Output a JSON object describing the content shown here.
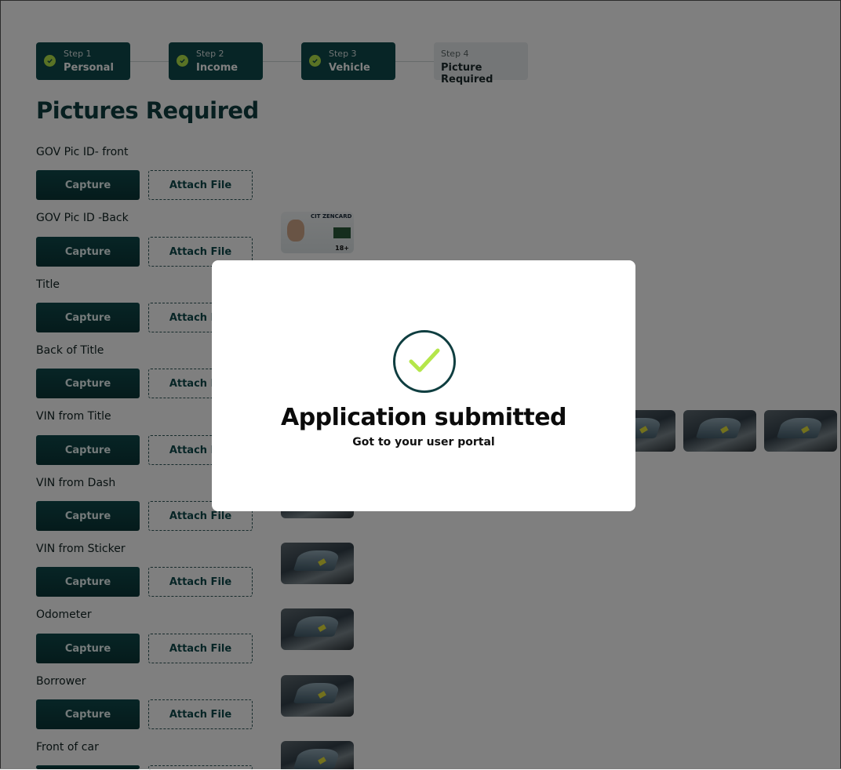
{
  "stepper": [
    {
      "num": "Step 1",
      "name": "Personal",
      "done": true
    },
    {
      "num": "Step 2",
      "name": "Income",
      "done": true
    },
    {
      "num": "Step 3",
      "name": "Vehicle",
      "done": true
    },
    {
      "num": "Step 4",
      "name": "Picture Required",
      "done": false
    }
  ],
  "page_title": "Pictures Required",
  "capture_label": "Capture",
  "attach_label": "Attach File",
  "rows": [
    {
      "label": "GOV Pic ID- front"
    },
    {
      "label": "GOV Pic ID -Back"
    },
    {
      "label": "Title"
    },
    {
      "label": "Back of Title"
    },
    {
      "label": "VIN from Title"
    },
    {
      "label": "VIN from Dash"
    },
    {
      "label": "VIN from Sticker"
    },
    {
      "label": "Odometer"
    },
    {
      "label": "Borrower"
    },
    {
      "label": "Front of car"
    }
  ],
  "id_card": {
    "header": "CIT ZENCARD",
    "age": "18+"
  },
  "modal": {
    "title": "Application submitted",
    "subtitle": "Got to your user portal",
    "icon": "check-circle-icon"
  },
  "colors": {
    "primary": "#0f4a4c",
    "accent": "#b4e64a",
    "overlay": "rgba(0,0,0,0.5)"
  }
}
